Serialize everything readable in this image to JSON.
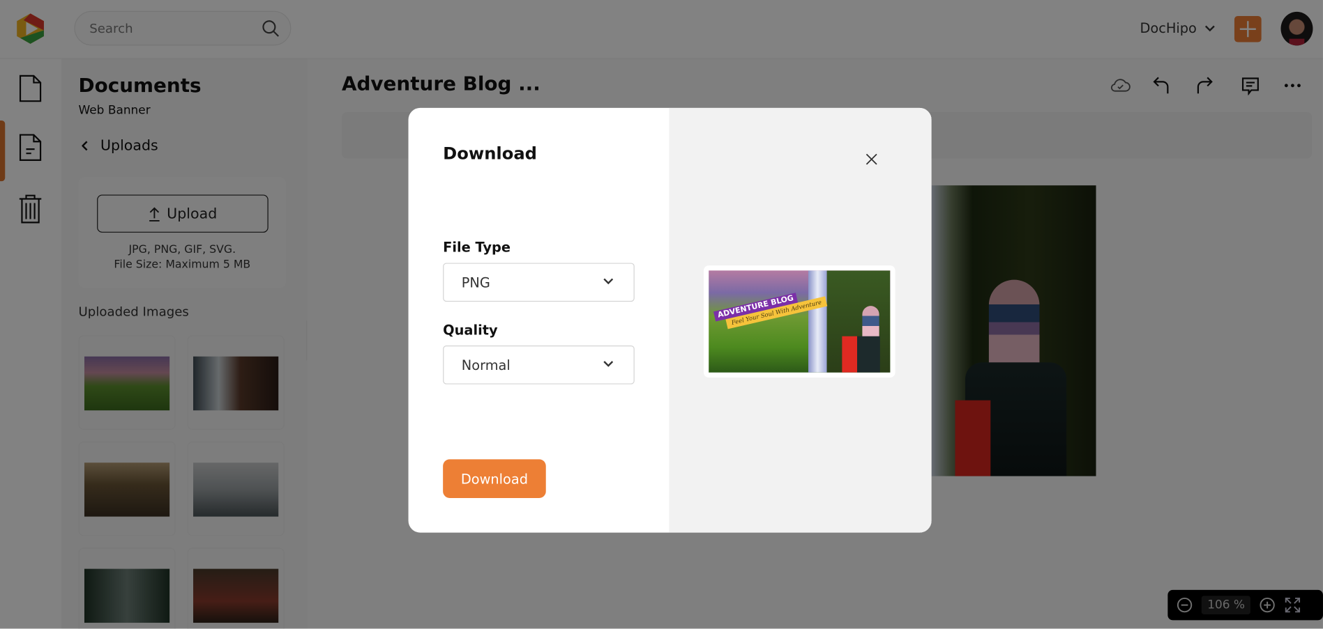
{
  "topbar": {
    "search_placeholder": "Search",
    "account": "DocHipo",
    "add_icon": "plus-icon",
    "avatar": "user-avatar"
  },
  "rail": {
    "items": [
      "document-icon",
      "file-text-icon",
      "trash-icon"
    ],
    "active_index": 1
  },
  "panel": {
    "title": "Documents",
    "subtitle": "Web Banner",
    "back_label": "Uploads",
    "upload_label": "Upload",
    "upload_hint_1": "JPG, PNG, GIF, SVG.",
    "upload_hint_2": "File Size: Maximum 5 MB",
    "uploaded_heading": "Uploaded Images"
  },
  "editor": {
    "title": "Adventure Blog ...",
    "toolbar": [
      "cloud-saved-icon",
      "undo-icon",
      "redo-icon",
      "comment-icon",
      "more-icon"
    ],
    "zoom": "106 %"
  },
  "modal": {
    "title": "Download",
    "file_type_label": "File Type",
    "file_type_value": "PNG",
    "quality_label": "Quality",
    "quality_value": "Normal",
    "download_label": "Download",
    "preview_banner": {
      "title": "ADVENTURE BLOG",
      "tagline": "Feel Your Soul With Adventure"
    }
  },
  "colors": {
    "accent": "#ed7f35",
    "banner_purple": "#7b2fa8",
    "banner_yellow": "#f6c33b"
  }
}
